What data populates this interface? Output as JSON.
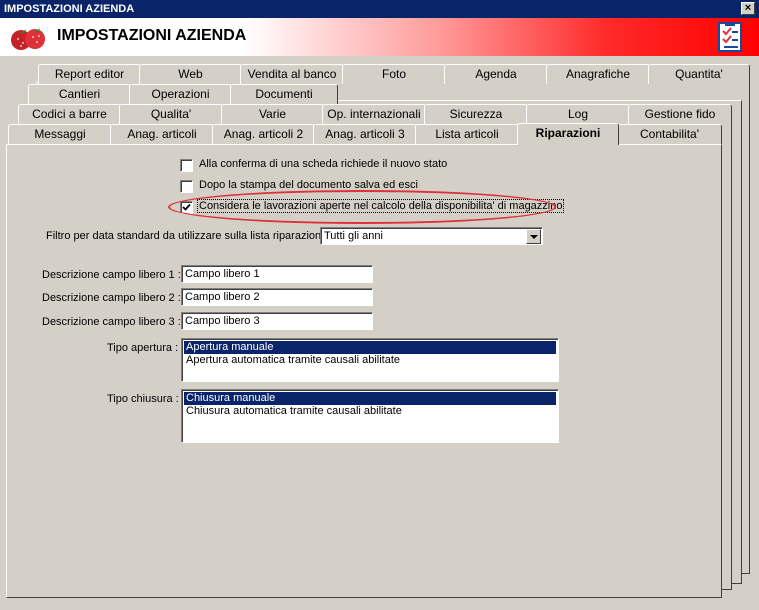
{
  "window": {
    "title": "IMPOSTAZIONI AZIENDA",
    "close_symbol": "×"
  },
  "header": {
    "title": "IMPOSTAZIONI AZIENDA",
    "logo_icon": "strawberry-logo",
    "right_icon": "checklist-icon"
  },
  "tabs": {
    "row1": [
      "Report editor",
      "Web",
      "Vendita al banco",
      "Foto",
      "Agenda",
      "Anagrafiche",
      "Quantita'"
    ],
    "row2": [
      "Cantieri",
      "Operazioni",
      "Documenti"
    ],
    "row3": [
      "Codici a barre",
      "Qualita'",
      "Varie",
      "Op. internazionali",
      "Sicurezza",
      "Log",
      "Gestione fido"
    ],
    "row4": [
      "Messaggi",
      "Anag. articoli",
      "Anag. articoli 2",
      "Anag. articoli 3",
      "Lista articoli",
      "Riparazioni",
      "Contabilita'"
    ],
    "active": "Riparazioni"
  },
  "options": {
    "opt1": {
      "label": "Alla conferma di una scheda richiede il nuovo stato",
      "checked": false
    },
    "opt2": {
      "label": "Dopo la stampa del documento salva ed esci",
      "checked": false
    },
    "opt3": {
      "label": "Considera le lavorazioni aperte nel calcolo della disponibilita' di magazzino",
      "checked": true
    }
  },
  "filter": {
    "label": "Filtro per data standard da utilizzare sulla lista riparazioni :",
    "value": "Tutti gli anni"
  },
  "free_fields": [
    {
      "label": "Descrizione campo libero 1 :",
      "value": "Campo libero 1"
    },
    {
      "label": "Descrizione campo libero 2 :",
      "value": "Campo libero 2"
    },
    {
      "label": "Descrizione campo libero 3 :",
      "value": "Campo libero 3"
    }
  ],
  "tipo_apertura": {
    "label": "Tipo apertura :",
    "items": [
      "Apertura manuale",
      "Apertura automatica tramite causali abilitate"
    ],
    "selected": 0
  },
  "tipo_chiusura": {
    "label": "Tipo chiusura :",
    "items": [
      "Chiusura manuale",
      "Chiusura automatica tramite causali abilitate"
    ],
    "selected": 0
  },
  "colors": {
    "titlebar": "#0a246a",
    "selection": "#0a246a",
    "highlight": "#e0303a",
    "window_bg": "#d4d0c8"
  }
}
